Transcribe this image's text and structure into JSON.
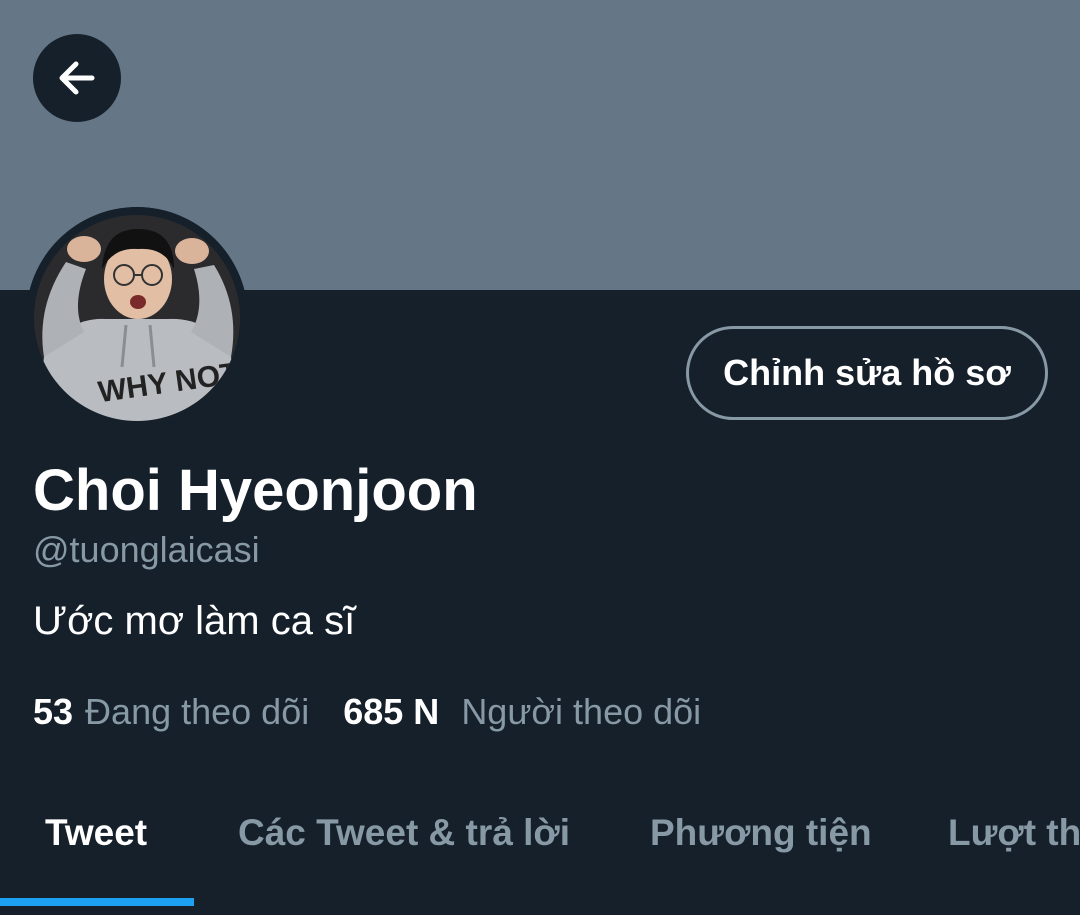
{
  "header": {
    "back_icon": "arrow-left-icon"
  },
  "profile": {
    "name": "Choi Hyeonjoon",
    "handle": "@tuonglaicasi",
    "bio": "Ước mơ làm ca sĩ",
    "edit_button_label": "Chỉnh sửa hồ sơ",
    "avatar_icon": "profile-photo"
  },
  "stats": {
    "following_count": "53",
    "following_label": "Đang theo dõi",
    "followers_count": "685 N",
    "followers_label": "Người theo dõi"
  },
  "tabs": [
    {
      "label": "Tweet",
      "active": true
    },
    {
      "label": "Các Tweet & trả lời",
      "active": false
    },
    {
      "label": "Phương tiện",
      "active": false
    },
    {
      "label": "Lượt thích",
      "active": false
    }
  ],
  "colors": {
    "background": "#15202b",
    "banner": "#657786",
    "accent": "#1da1f2",
    "secondary_text": "#8899a6",
    "primary_text": "#ffffff"
  }
}
